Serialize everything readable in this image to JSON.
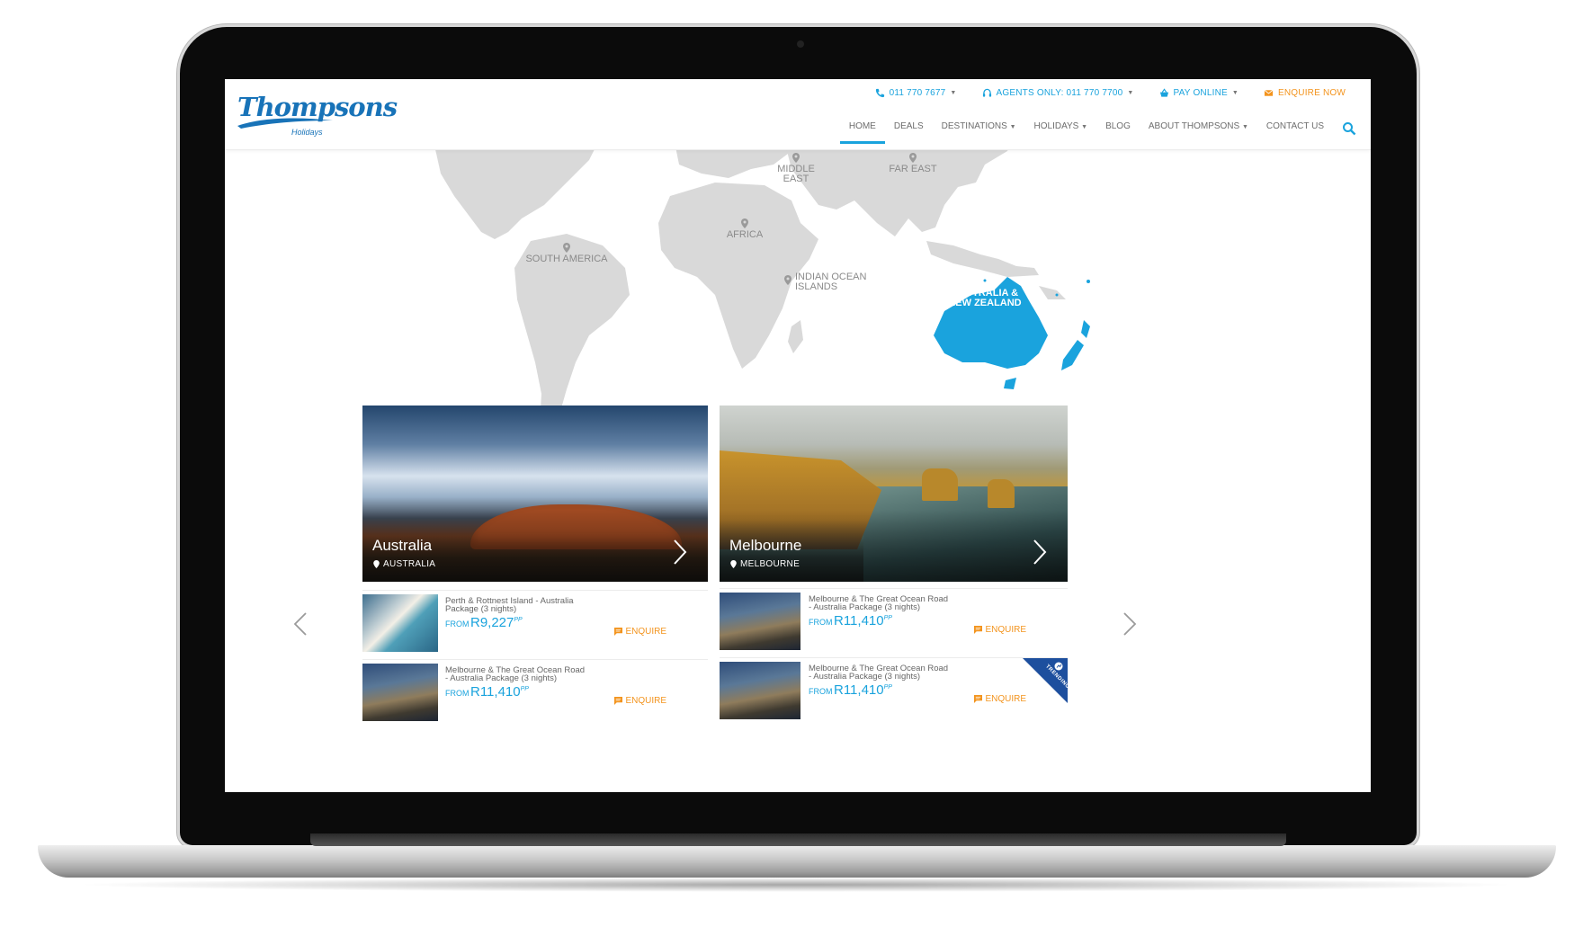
{
  "header": {
    "logo": {
      "name": "Thompsons",
      "sub": "Holidays"
    },
    "topbar": {
      "phone": "011 770 7677",
      "agents": "AGENTS ONLY: 011 770 7700",
      "pay_online": "PAY ONLINE",
      "enquire_now": "ENQUIRE NOW"
    },
    "nav": {
      "home": "HOME",
      "deals": "DEALS",
      "destinations": "DESTINATIONS",
      "holidays": "HOLIDAYS",
      "blog": "BLOG",
      "about": "ABOUT THOMPSONS",
      "contact": "CONTACT US"
    }
  },
  "map": {
    "middle_east": "MIDDLE EAST",
    "far_east": "FAR EAST",
    "africa": "AFRICA",
    "south_america": "SOUTH AMERICA",
    "indian_ocean": "INDIAN OCEAN ISLANDS",
    "australia_nz": "AUSTRALIA & NEW ZEALAND",
    "active_color": "#1aa3dd",
    "land_color": "#d9d9d9"
  },
  "cards": [
    {
      "title": "Australia",
      "location": "AUSTRALIA",
      "deals": [
        {
          "title": "Perth & Rottnest Island - Australia Package (3 nights)",
          "from": "FROM",
          "price": "R9,227",
          "pp": "PP",
          "cta": "ENQUIRE"
        },
        {
          "title": "Melbourne & The Great Ocean Road - Australia Package (3 nights)",
          "from": "FROM",
          "price": "R11,410",
          "pp": "PP",
          "cta": "ENQUIRE"
        }
      ]
    },
    {
      "title": "Melbourne",
      "location": "MELBOURNE",
      "deals": [
        {
          "title": "Melbourne & The Great Ocean Road - Australia Package (3 nights)",
          "from": "FROM",
          "price": "R11,410",
          "pp": "PP",
          "cta": "ENQUIRE"
        },
        {
          "title": "Melbourne & The Great Ocean Road - Australia Package (3 nights)",
          "from": "FROM",
          "price": "R11,410",
          "pp": "PP",
          "cta": "ENQUIRE",
          "badge": "TRENDING"
        }
      ]
    }
  ]
}
